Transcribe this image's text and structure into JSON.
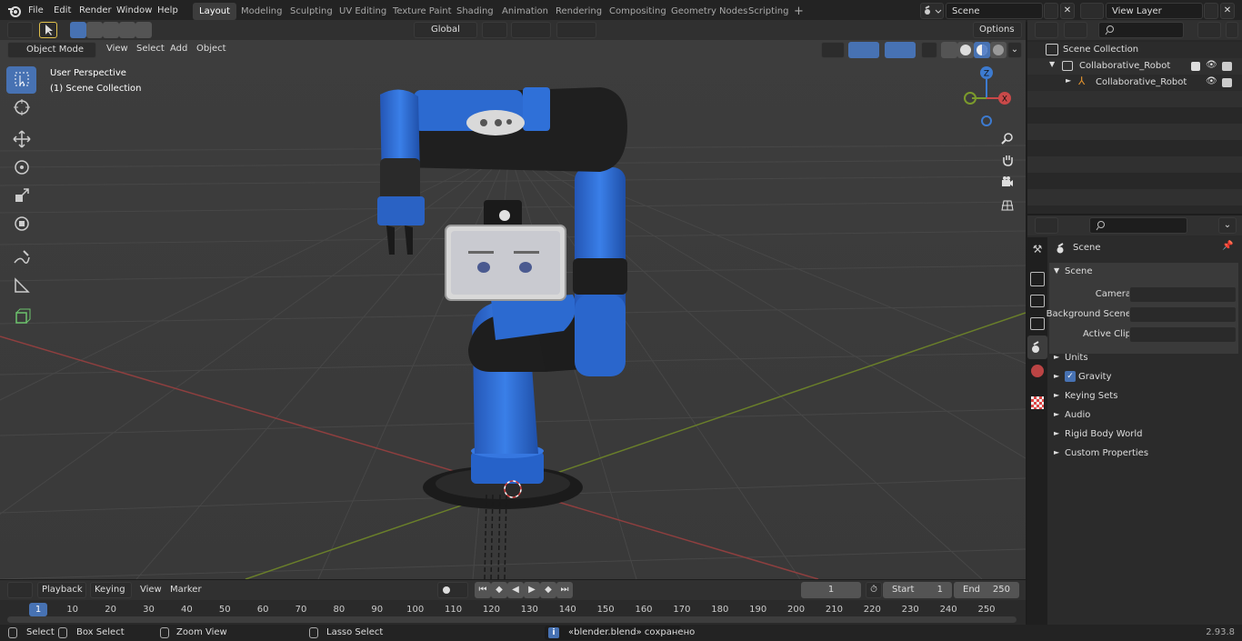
{
  "topbar": {
    "menus": [
      "File",
      "Edit",
      "Render",
      "Window",
      "Help"
    ],
    "workspaces": [
      "Layout",
      "Modeling",
      "Sculpting",
      "UV Editing",
      "Texture Paint",
      "Shading",
      "Animation",
      "Rendering",
      "Compositing",
      "Geometry Nodes",
      "Scripting"
    ],
    "active_workspace": "Layout",
    "add_tab": "+",
    "scene_name": "Scene",
    "view_layer": "View Layer"
  },
  "viewport_header": {
    "mode": "Object Mode",
    "menus": [
      "View",
      "Select",
      "Add",
      "Object"
    ],
    "orientation": "Global",
    "options": "Options"
  },
  "viewport": {
    "perspective": "User Perspective",
    "collection": "(1) Scene Collection",
    "gizmo": {
      "z": "Z",
      "x": "X",
      "y": "Y"
    }
  },
  "outliner": {
    "root": "Scene Collection",
    "items": [
      {
        "label": "Collaborative_Robot",
        "type": "collection"
      },
      {
        "label": "Collaborative_Robot",
        "type": "armature"
      }
    ]
  },
  "properties": {
    "context": "Scene",
    "panel": "Scene",
    "fields": [
      {
        "label": "Camera",
        "value": ""
      },
      {
        "label": "Background Scene",
        "value": ""
      },
      {
        "label": "Active Clip",
        "value": ""
      }
    ],
    "subpanels": [
      "Units",
      "Gravity",
      "Keying Sets",
      "Audio",
      "Rigid Body World",
      "Custom Properties"
    ]
  },
  "timeline": {
    "menus": [
      "Playback",
      "Keying",
      "View",
      "Marker"
    ],
    "current_frame": "1",
    "start_label": "Start",
    "start": "1",
    "end_label": "End",
    "end": "250",
    "ticks": [
      "1",
      "10",
      "20",
      "30",
      "40",
      "50",
      "60",
      "70",
      "80",
      "90",
      "100",
      "110",
      "120",
      "130",
      "140",
      "150",
      "160",
      "170",
      "180",
      "190",
      "200",
      "210",
      "220",
      "230",
      "240",
      "250"
    ]
  },
  "statusbar": {
    "select": "Select",
    "box_select": "Box Select",
    "zoom_view": "Zoom View",
    "lasso_select": "Lasso Select",
    "message": "«blender.blend» сохранено",
    "version": "2.93.8"
  },
  "colors": {
    "accent": "#4772b3",
    "robot_blue": "#2f6fd6",
    "robot_dark": "#1c1c1c",
    "x_axis": "#c94949",
    "y_axis": "#7b9a2c"
  }
}
